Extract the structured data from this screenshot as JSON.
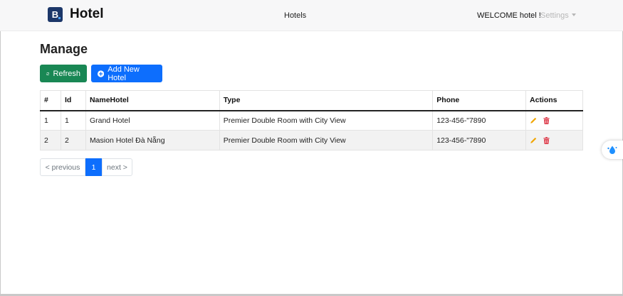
{
  "brand": {
    "logo_letter": "B",
    "name": "Hotel"
  },
  "nav": {
    "center_link": "Hotels",
    "welcome": "WELCOME hotel !",
    "settings": "Settings"
  },
  "page": {
    "title": "Manage"
  },
  "toolbar": {
    "refresh_label": "Refresh",
    "add_label": "Add New Hotel"
  },
  "table": {
    "headers": [
      "#",
      "Id",
      "NameHotel",
      "Type",
      "Phone",
      "Actions"
    ],
    "rows": [
      {
        "no": "1",
        "id": "1",
        "name": "Grand Hotel",
        "type": "Premier Double Room with City View",
        "phone": "123-456-\"7890"
      },
      {
        "no": "2",
        "id": "2",
        "name": "Masion Hotel Đà Nẵng",
        "type": "Premier Double Room with City View",
        "phone": "123-456-\"7890"
      }
    ]
  },
  "pagination": {
    "prev": "< previous",
    "current": "1",
    "next": "next >"
  },
  "colors": {
    "brand": "#1c3769",
    "refresh": "#198754",
    "primary": "#0d6efd",
    "edit": "#f0a500",
    "delete": "#dc3545"
  },
  "icons": {
    "refresh": "refresh-icon",
    "add": "plus-circle-icon",
    "edit": "pencil-icon",
    "delete": "trash-icon",
    "widget": "water-drop-icon"
  }
}
